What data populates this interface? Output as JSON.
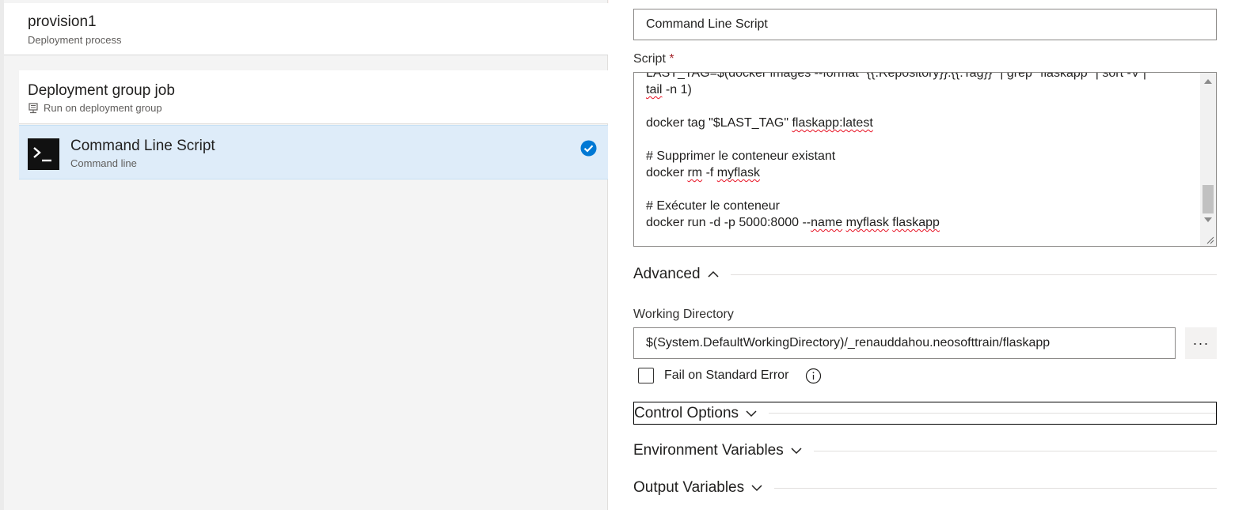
{
  "left_panel": {
    "header": {
      "title": "provision1",
      "subtitle": "Deployment process"
    },
    "job": {
      "title": "Deployment group job",
      "subtitle": "Run on deployment group",
      "icon": "deployment-group-icon"
    },
    "task": {
      "title": "Command Line Script",
      "subtitle": "Command line",
      "icon": "terminal-icon",
      "status_icon": "check-circle-icon",
      "selected": true
    }
  },
  "right_panel": {
    "display_name": {
      "value": "Command Line Script"
    },
    "script": {
      "label": "Script",
      "required_marker": "*",
      "lines": [
        "LAST_TAG=$(docker images --format \"{{.Repository}}:{{.Tag}}\" | grep \"flaskapp\" | sort -V |",
        "tail -n 1)",
        "",
        "docker tag \"$LAST_TAG\" flaskapp:latest",
        "",
        "# Supprimer le conteneur existant",
        "docker rm -f myflask",
        "",
        "# Exécuter le conteneur",
        "docker run -d -p 5000:8000 --name myflask flaskapp"
      ]
    },
    "sections": {
      "advanced": {
        "label": "Advanced",
        "expanded": true
      },
      "control_options": {
        "label": "Control Options",
        "expanded": false
      },
      "environment_variables": {
        "label": "Environment Variables",
        "expanded": false
      },
      "output_variables": {
        "label": "Output Variables",
        "expanded": false
      }
    },
    "working_directory": {
      "label": "Working Directory",
      "value": "$(System.DefaultWorkingDirectory)/_renauddahou.neosofttrain/flaskapp",
      "browse_label": "···"
    },
    "fail_on_stderr": {
      "label": "Fail on Standard Error",
      "checked": false,
      "info_icon": "info-icon"
    }
  },
  "colors": {
    "selected_bg": "#deecf9",
    "accent": "#0078d4",
    "required": "#a4262c",
    "spellcheck": "#e81123"
  }
}
